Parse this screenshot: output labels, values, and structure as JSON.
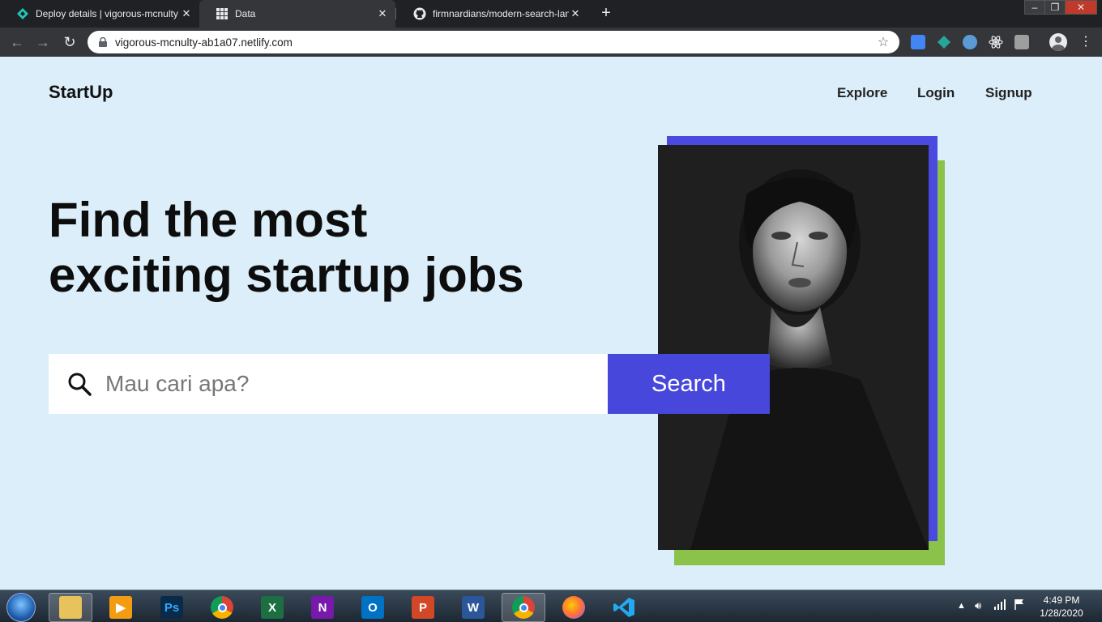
{
  "browser": {
    "tabs": [
      {
        "title": "Deploy details | vigorous-mcnulty",
        "icon": "netlify-icon",
        "active": false
      },
      {
        "title": "Data",
        "icon": "grid-apps-icon",
        "active": true
      },
      {
        "title": "firmnardians/modern-search-lan",
        "icon": "github-icon",
        "active": false
      }
    ],
    "close_glyph": "✕",
    "new_tab_glyph": "+",
    "url": "vigorous-mcnulty-ab1a07.netlify.com"
  },
  "page": {
    "brand": "StartUp",
    "nav": [
      {
        "label": "Explore"
      },
      {
        "label": "Login"
      },
      {
        "label": "Signup"
      }
    ],
    "hero": {
      "line1": "Find the most",
      "line2": "exciting startup jobs"
    },
    "search": {
      "placeholder": "Mau cari apa?",
      "value": "",
      "button_label": "Search"
    },
    "colors": {
      "background": "#dbeefa",
      "accent_blue": "#4747db",
      "accent_green": "#8bc34a"
    }
  },
  "taskbar": {
    "apps": [
      {
        "name": "explorer",
        "icon": "folder-icon"
      },
      {
        "name": "media",
        "icon": "media-player-icon"
      },
      {
        "name": "photoshop",
        "icon": "photoshop-icon",
        "glyph": "Ps"
      },
      {
        "name": "chrome",
        "icon": "chrome-icon"
      },
      {
        "name": "excel",
        "icon": "excel-icon",
        "glyph": "X"
      },
      {
        "name": "onenote",
        "icon": "onenote-icon",
        "glyph": "N"
      },
      {
        "name": "outlook",
        "icon": "outlook-icon",
        "glyph": "O"
      },
      {
        "name": "powerpoint",
        "icon": "powerpoint-icon",
        "glyph": "P"
      },
      {
        "name": "word",
        "icon": "word-icon",
        "glyph": "W"
      },
      {
        "name": "chrome-active",
        "icon": "chrome-icon"
      },
      {
        "name": "firefox",
        "icon": "firefox-icon"
      },
      {
        "name": "vscode",
        "icon": "vscode-icon"
      }
    ],
    "time": "4:49 PM",
    "date": "1/28/2020"
  }
}
